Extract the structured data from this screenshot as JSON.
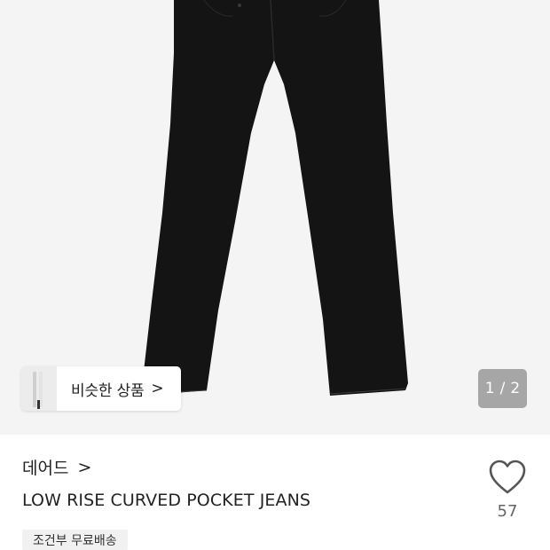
{
  "gallery": {
    "similar_label": "비슷한 상품",
    "similar_chevron": ">",
    "page_current": "1",
    "page_separator": "/",
    "page_total": "2",
    "image_icon": "black-flare-jeans-photo"
  },
  "product": {
    "brand": "데어드",
    "brand_chevron": ">",
    "title": "LOW RISE CURVED POCKET JEANS",
    "shipping_badge": "조건부 무료배송",
    "like_count": "57",
    "like_icon": "heart-outline-icon"
  },
  "colors": {
    "image_bg": "#f4f4f4",
    "jeans": "#141414",
    "badge_bg": "#f1f1f1",
    "indicator_bg": "#8c8c8c"
  }
}
